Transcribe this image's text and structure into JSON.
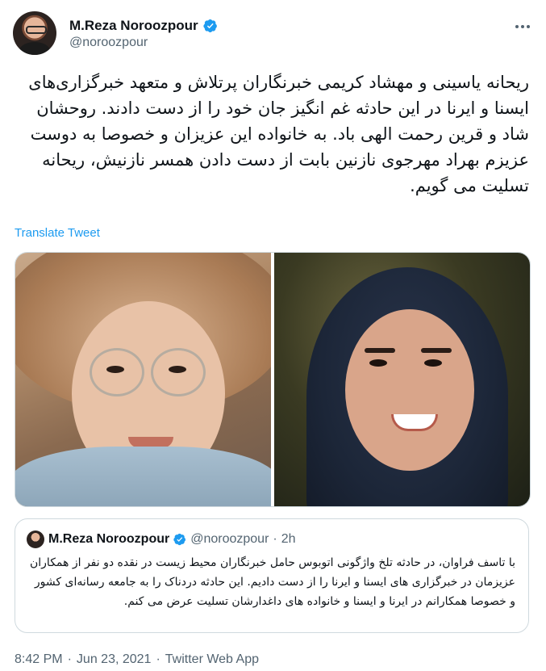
{
  "tweet": {
    "author_name": "M.Reza Noroozpour",
    "author_handle": "@noroozpour",
    "text": "ریحانه یاسینی و مهشاد کریمی خبرنگاران پرتلاش و متعهد خبرگزاری‌های ایسنا و ایرنا در این حادثه غم انگیز جان خود را از دست دادند. روحشان شاد و قرین رحمت الهی باد. به خانواده این عزیزان و خصوصا به دوست عزیزم بهراد مهرجوی نازنین بابت از دست دادن همسر نازنیش، ریحانه تسلیت می گویم.",
    "translate_label": "Translate Tweet",
    "time": "8:42 PM",
    "separator": "·",
    "date": "Jun 23, 2021",
    "source": "Twitter Web App"
  },
  "quoted_tweet": {
    "author_name": "M.Reza Noroozpour",
    "author_handle": "@noroozpour",
    "separator": "·",
    "age": "2h",
    "text": "با تاسف فراوان، در حادثه تلخ واژگونی اتوبوس حامل خبرنگاران محیط زیست در نقده دو نفر از همکاران عزیزمان در خبرگزاری های ایسنا و ایرنا را از دست دادیم. این حادثه دردناک را به جامعه رسانه‌ای کشور و خصوصا همکارانم در ایرنا و ایسنا و خانواده های داغدارشان تسلیت عرض می کنم."
  },
  "icons": {
    "verified": "verified-badge-icon",
    "more": "more-options-icon"
  },
  "colors": {
    "link": "#1d9bf0",
    "secondary_text": "#536471",
    "border": "#cfd9de"
  }
}
